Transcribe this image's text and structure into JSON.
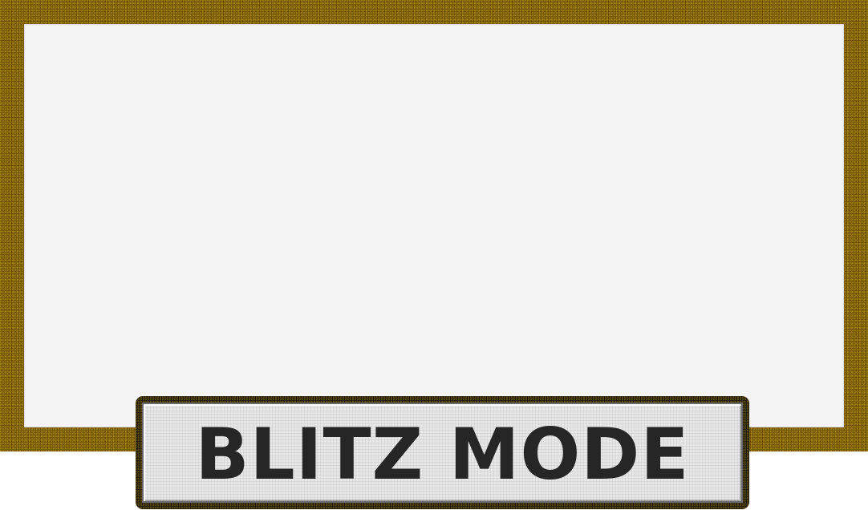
{
  "colors": {
    "frame": "#7a5c00",
    "board": "#f4f4f4",
    "plate_border": "#1a1608",
    "plate_face": "#e8e8e8",
    "title_text": "#262626"
  },
  "mode_banner": {
    "title": "BLITZ MODE"
  }
}
